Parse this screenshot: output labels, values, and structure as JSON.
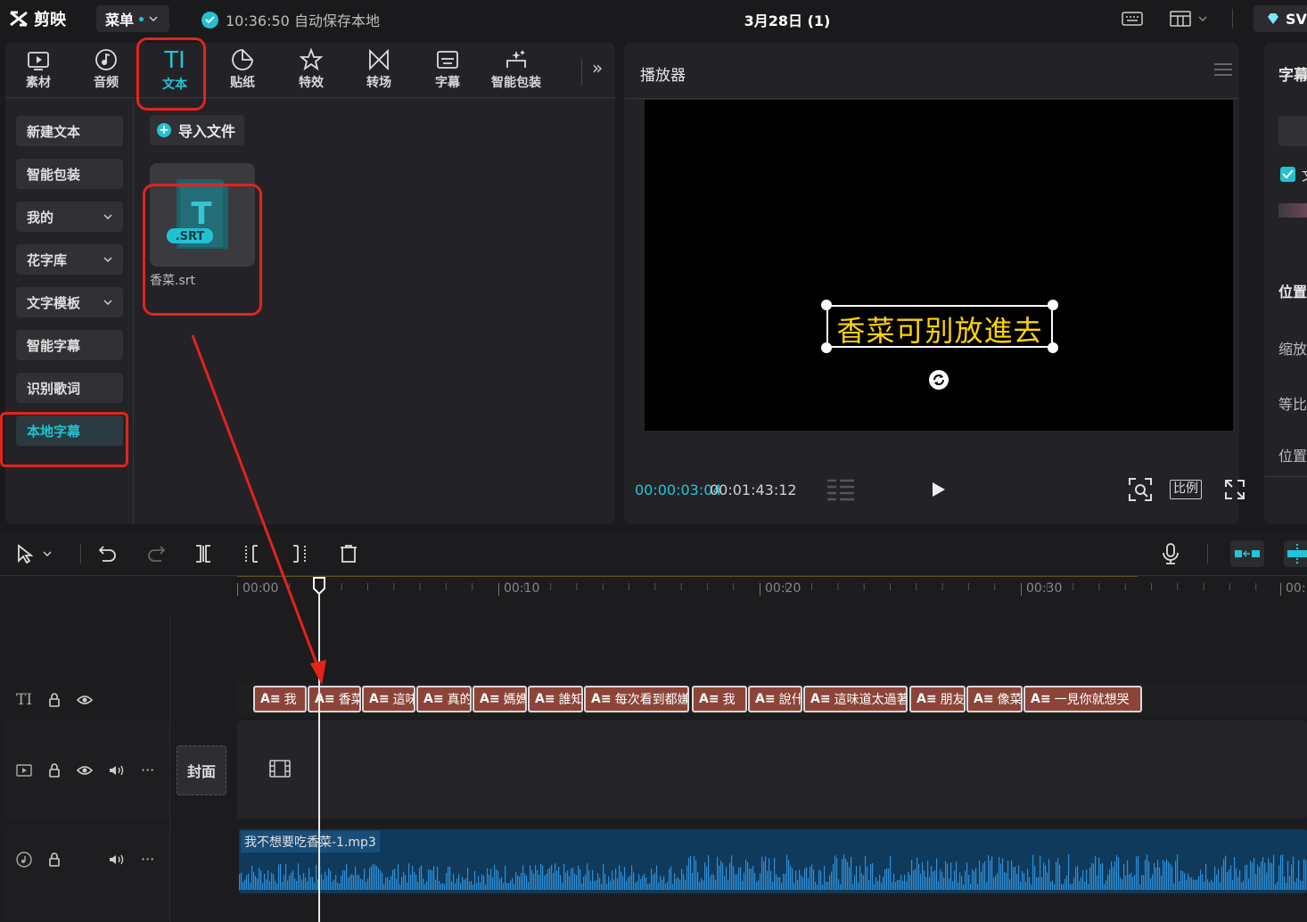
{
  "app": {
    "name": "剪映",
    "menu_label": "菜单",
    "save_status": "10:36:50 自动保存本地",
    "project_title": "3月28日 (1)",
    "pro_label": "SV"
  },
  "toolbar": {
    "tools": [
      {
        "label": "素材",
        "icon": "media-icon"
      },
      {
        "label": "音频",
        "icon": "audio-icon"
      },
      {
        "label": "文本",
        "icon": "text-icon",
        "tool_glyph": "TI"
      },
      {
        "label": "贴纸",
        "icon": "sticker-icon"
      },
      {
        "label": "特效",
        "icon": "effects-icon"
      },
      {
        "label": "转场",
        "icon": "transition-icon"
      },
      {
        "label": "字幕",
        "icon": "subtitle-icon"
      },
      {
        "label": "智能包装",
        "icon": "smart-pack-icon"
      }
    ],
    "more_label": "»"
  },
  "sidebar": {
    "items": [
      {
        "label": "新建文本",
        "has_arrow": false
      },
      {
        "label": "智能包装",
        "has_arrow": false
      },
      {
        "label": "我的",
        "has_arrow": true
      },
      {
        "label": "花字库",
        "has_arrow": true
      },
      {
        "label": "文字模板",
        "has_arrow": true
      },
      {
        "label": "智能字幕",
        "has_arrow": false
      },
      {
        "label": "识别歌词",
        "has_arrow": false
      },
      {
        "label": "本地字幕",
        "has_arrow": false,
        "active": true
      }
    ]
  },
  "import": {
    "label": "导入文件"
  },
  "file": {
    "badge": ".SRT",
    "glyph": "T",
    "name": "香菜.srt"
  },
  "player": {
    "title": "播放器",
    "subtitle_text": "香菜可别放進去",
    "time_current": "00:00:03:04",
    "time_separator": "/",
    "time_total": "00:01:43:12",
    "ratio_label": "比例"
  },
  "right_panel": {
    "title": "字幕",
    "checkbox_label": "文",
    "labels": [
      "位置",
      "缩放",
      "等比",
      "位置"
    ]
  },
  "timeline": {
    "ruler": [
      "00:00",
      "00:10",
      "00:20",
      "00:30",
      "00:"
    ],
    "text_track_icon": "TI",
    "cover_label": "封面",
    "audio_clip": "我不想要吃香菜-1.mp3",
    "subtitle_clips": [
      "我",
      "香菜",
      "這味",
      "真的",
      "媽媽",
      "誰知",
      "每次看到都嫌",
      "我",
      "說什",
      "這味道太過著",
      "朋友",
      "像菜",
      "一見你就想哭"
    ]
  },
  "colors": {
    "accent": "#22c5d6",
    "highlight": "#e3231c",
    "subtitle": "#ffd400",
    "clip": "#8c4438"
  }
}
